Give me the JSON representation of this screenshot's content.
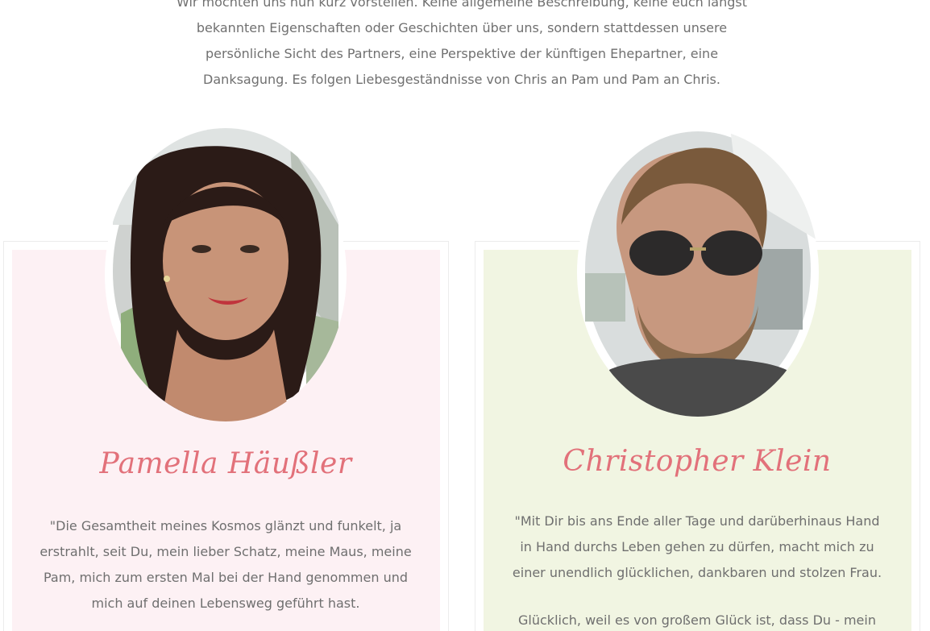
{
  "intro": {
    "text": "Wir möchten uns nun kurz vorstellen. Keine allgemeine Beschreibung, keine euch längst bekannten Eigenschaften oder Geschichten über uns, sondern stattdessen unsere persönliche Sicht des Partners, eine Perspektive der künftigen Ehepartner, eine Danksagung. Es folgen Liebesgeständnisse von Chris an Pam und Pam an Chris."
  },
  "cards": [
    {
      "name": "Pamella Häußler",
      "quote": "\"Die Gesamtheit meines Kosmos glänzt und funkelt, ja erstrahlt, seit Du, mein lieber Schatz, meine Maus, meine Pam, mich zum ersten Mal bei der Hand genommen und mich auf deinen Lebensweg geführt hast.",
      "background": "#fdf1f4"
    },
    {
      "name": "Christopher Klein",
      "quote": "\"Mit Dir bis ans Ende aller Tage und darüberhinaus Hand in Hand durchs Leben gehen zu dürfen, macht mich zu einer unendlich glücklichen, dankbaren und stolzen Frau.",
      "quote_2": "Glücklich, weil es von großem Glück ist, dass Du - mein",
      "background": "#f1f5e2"
    }
  ],
  "colors": {
    "name_accent": "#e2717a",
    "body_text": "#6f6f6f"
  }
}
